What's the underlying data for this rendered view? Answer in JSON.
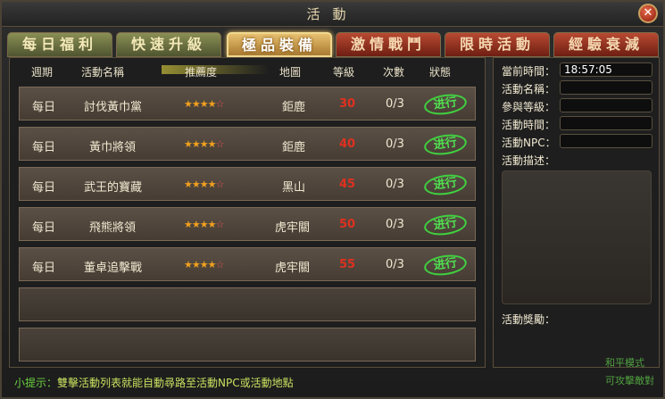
{
  "window": {
    "title": "活動"
  },
  "tabs": [
    {
      "label": "每日福利",
      "style": "green"
    },
    {
      "label": "快速升級",
      "style": "green"
    },
    {
      "label": "極品裝備",
      "style": "active"
    },
    {
      "label": "激情戰鬥",
      "style": "red"
    },
    {
      "label": "限時活動",
      "style": "red"
    },
    {
      "label": "經驗衰減",
      "style": "red"
    }
  ],
  "table": {
    "columns": [
      "週期",
      "活動名稱",
      "推薦度",
      "地圖",
      "等級",
      "次數",
      "狀態"
    ],
    "rows": [
      {
        "period": "每日",
        "name": "討伐黃巾黨",
        "stars": "★★★★",
        "last_star": "☆",
        "map": "鉅鹿",
        "level": "30",
        "count": "0/3",
        "status": "进行"
      },
      {
        "period": "每日",
        "name": "黃巾將領",
        "stars": "★★★★",
        "last_star": "☆",
        "map": "鉅鹿",
        "level": "40",
        "count": "0/3",
        "status": "进行"
      },
      {
        "period": "每日",
        "name": "武王的寶藏",
        "stars": "★★★★",
        "last_star": "☆",
        "map": "黑山",
        "level": "45",
        "count": "0/3",
        "status": "进行"
      },
      {
        "period": "每日",
        "name": "飛熊將領",
        "stars": "★★★★",
        "last_star": "☆",
        "map": "虎牢關",
        "level": "50",
        "count": "0/3",
        "status": "进行"
      },
      {
        "period": "每日",
        "name": "董卓追擊戰",
        "stars": "★★★★",
        "last_star": "☆",
        "map": "虎牢關",
        "level": "55",
        "count": "0/3",
        "status": "进行"
      }
    ]
  },
  "side": {
    "current_time_label": "當前時間：",
    "current_time_value": "18:57:05",
    "name_label": "活動名稱：",
    "level_label": "參與等級：",
    "time_label": "活動時間：",
    "npc_label": "活動NPC：",
    "desc_label": "活動描述：",
    "reward_label": "活動獎勵："
  },
  "tip": {
    "prefix": "小提示：",
    "text": "雙擊活動列表就能自動尋路至活動NPC或活動地點"
  },
  "background_text": {
    "a": "和平模式",
    "b": "可攻擊敵對"
  },
  "colors": {
    "level_red": "#e03020",
    "status_green": "#50e050",
    "tip_green": "#6ad040"
  }
}
